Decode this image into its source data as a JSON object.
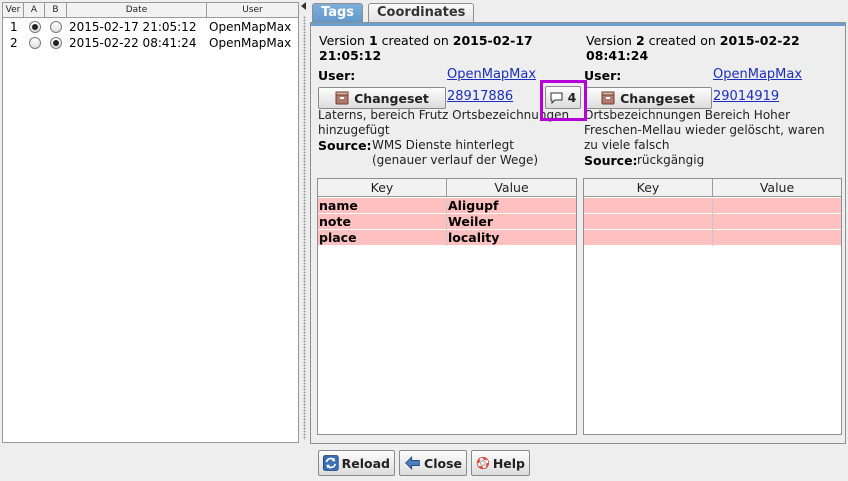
{
  "history": {
    "headers": {
      "ver": "Ver",
      "a": "A",
      "b": "B",
      "date": "Date",
      "user": "User"
    },
    "rows": [
      {
        "ver": "1",
        "a": true,
        "b": false,
        "date": "2015-02-17 21:05:12",
        "user": "OpenMapMax"
      },
      {
        "ver": "2",
        "a": false,
        "b": true,
        "date": "2015-02-22 08:41:24",
        "user": "OpenMapMax"
      }
    ]
  },
  "tabs": {
    "tags": "Tags",
    "coordinates": "Coordinates"
  },
  "left_version": {
    "title_prefix": "Version ",
    "number": "1",
    "title_mid": " created on ",
    "date": "2015-02-17",
    "time": "21:05:12",
    "user_label": "User:",
    "user": "OpenMapMax",
    "changeset_label": "Changeset",
    "changeset_id": "28917886",
    "comments_count": "4",
    "comment_line1": "Laterns, bereich Frutz Ortsbezeichnungen",
    "comment_line2": "hinzugefügt",
    "source_label": "Source:",
    "source_line1": "WMS Dienste hinterlegt",
    "source_line2": "(genauer verlauf der Wege)"
  },
  "right_version": {
    "title_prefix": "Version ",
    "number": "2",
    "title_mid": " created on ",
    "date": "2015-02-22",
    "time": "08:41:24",
    "user_label": "User:",
    "user": "OpenMapMax",
    "changeset_label": "Changeset",
    "changeset_id": "29014919",
    "comment_line1": "Ortsbezeichnungen Bereich Hoher",
    "comment_line2": "Freschen-Mellau wieder gelöscht, waren",
    "comment_line3": "zu viele falsch",
    "source_label": "Source:",
    "source_line1": "rückgängig"
  },
  "tag_table": {
    "key_header": "Key",
    "value_header": "Value",
    "left_rows": [
      {
        "key": "name",
        "value": "Aligupf"
      },
      {
        "key": "note",
        "value": "Weiler"
      },
      {
        "key": "place",
        "value": "locality"
      }
    ],
    "right_rows": [
      {
        "key": "",
        "value": ""
      },
      {
        "key": "",
        "value": ""
      },
      {
        "key": "",
        "value": ""
      }
    ],
    "removed_color": "#ffc0c0"
  },
  "bottom_buttons": {
    "reload": "Reload",
    "close": "Close",
    "help": "Help"
  },
  "colors": {
    "highlight": "#b400d6",
    "link": "#1a2fbf",
    "active_tab": "#6a9fd0"
  }
}
